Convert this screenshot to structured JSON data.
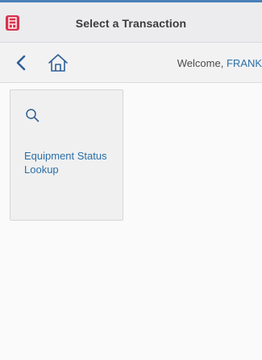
{
  "header": {
    "title": "Select a Transaction",
    "logo": "app-logo-icon",
    "accent_color": "#d9314e",
    "top_line_color": "#4a7fb8"
  },
  "nav": {
    "back_icon": "chevron-left-icon",
    "home_icon": "home-icon",
    "welcome_prefix": "Welcome, ",
    "user_name": "FRANK"
  },
  "tiles": [
    {
      "icon": "search-icon",
      "label": "Equipment Status Lookup"
    }
  ],
  "colors": {
    "link": "#2c6fa8",
    "icon": "#2f5f96"
  }
}
